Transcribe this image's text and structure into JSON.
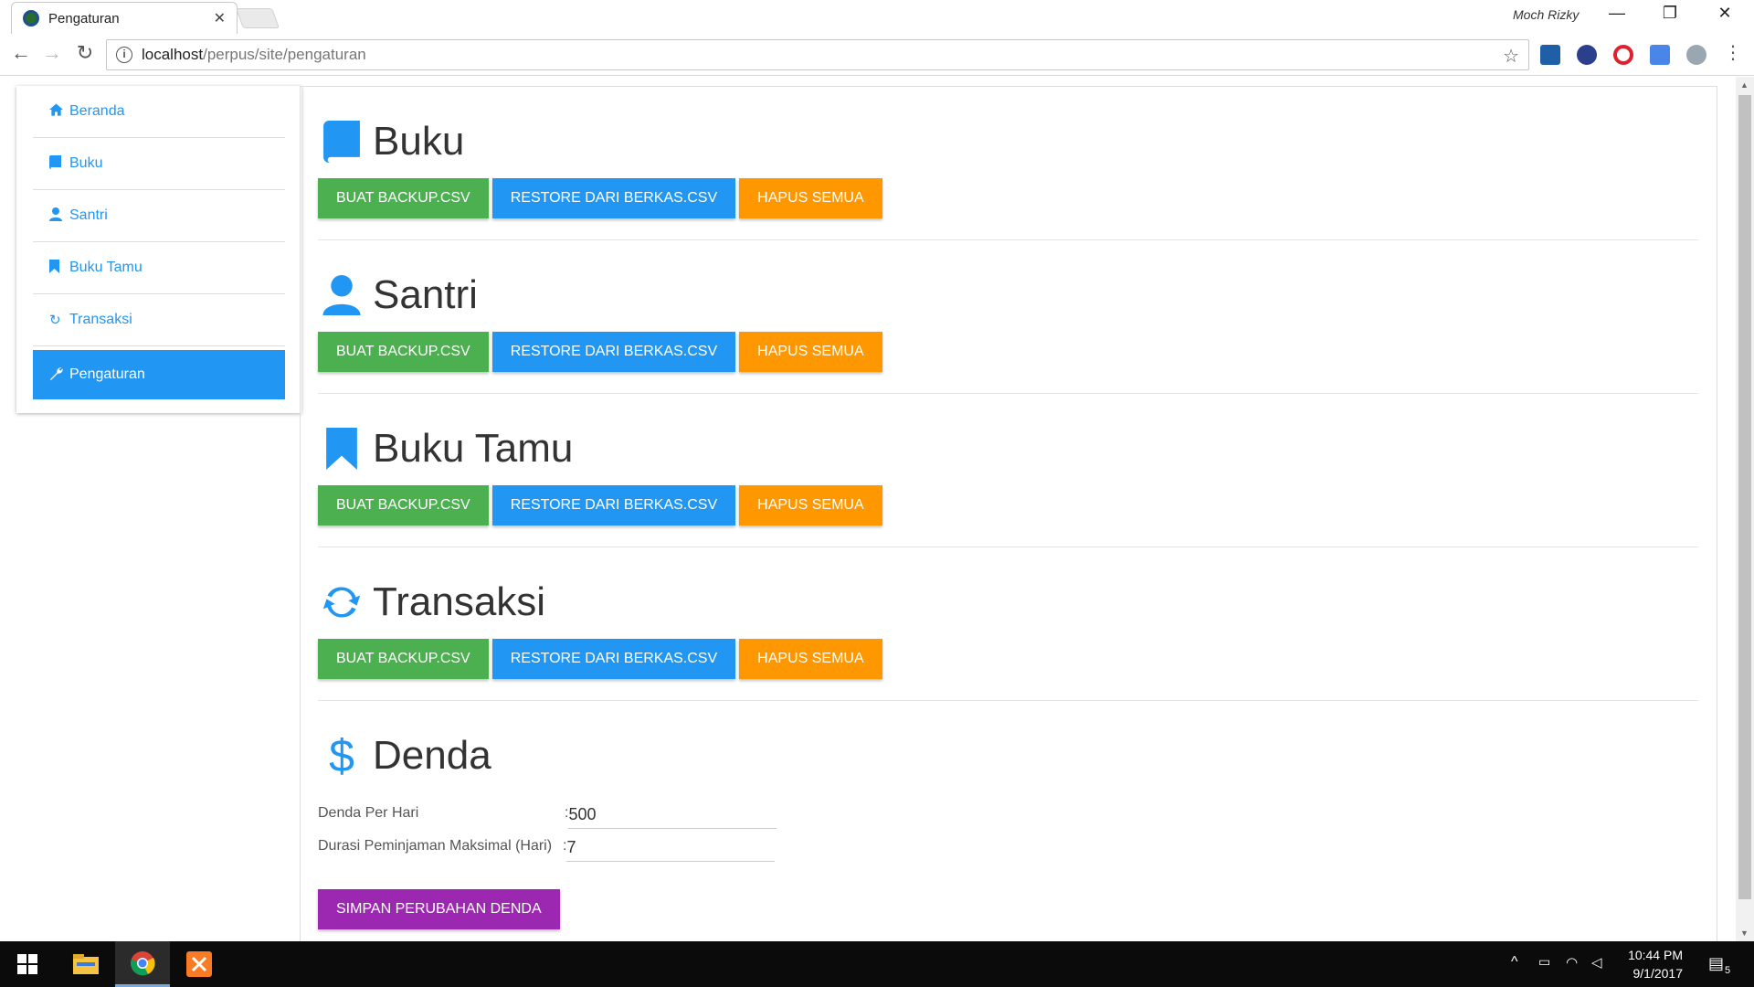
{
  "browser": {
    "tab_title": "Pengaturan",
    "profile_name": "Moch Rizky",
    "url_host": "localhost",
    "url_path": "/perpus/site/pengaturan"
  },
  "sidebar": {
    "items": [
      {
        "label": "Beranda",
        "icon": "home-icon"
      },
      {
        "label": "Buku",
        "icon": "book-icon"
      },
      {
        "label": "Santri",
        "icon": "user-icon"
      },
      {
        "label": "Buku Tamu",
        "icon": "bookmark-icon"
      },
      {
        "label": "Transaksi",
        "icon": "refresh-icon"
      },
      {
        "label": "Pengaturan",
        "icon": "wrench-icon",
        "active": true
      }
    ]
  },
  "sections": [
    {
      "title": "Buku",
      "icon": "book-icon"
    },
    {
      "title": "Santri",
      "icon": "user-icon"
    },
    {
      "title": "Buku Tamu",
      "icon": "bookmark-icon"
    },
    {
      "title": "Transaksi",
      "icon": "refresh-icon"
    }
  ],
  "buttons": {
    "backup": "BUAT BACKUP.CSV",
    "restore": "RESTORE DARI BERKAS.CSV",
    "delete_all": "HAPUS SEMUA"
  },
  "denda": {
    "title": "Denda",
    "icon": "dollar-icon",
    "per_day_label": "Denda Per Hari",
    "per_day_value": "500",
    "max_duration_label": "Durasi Peminjaman Maksimal (Hari)",
    "max_duration_value": "7",
    "colon": ":",
    "save_label": "SIMPAN PERUBAHAN DENDA"
  },
  "taskbar": {
    "time": "10:44 PM",
    "date": "9/1/2017",
    "notification_count": "5"
  },
  "colors": {
    "primary": "#2196f3",
    "green": "#4caf50",
    "orange": "#ff9800",
    "purple": "#9c27b0"
  }
}
